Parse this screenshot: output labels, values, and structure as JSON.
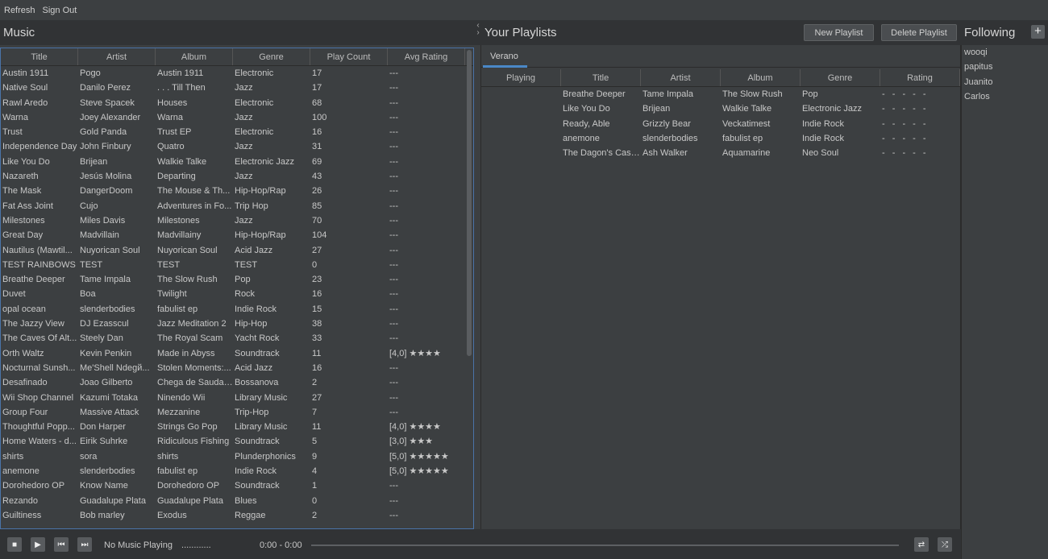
{
  "menu": {
    "refresh": "Refresh",
    "sign_out": "Sign Out"
  },
  "music": {
    "title": "Music",
    "columns": [
      "Title",
      "Artist",
      "Album",
      "Genre",
      "Play Count",
      "Avg Rating"
    ],
    "rows": [
      [
        "Austin 1911",
        "Pogo",
        "Austin 1911",
        "Electronic",
        "17",
        "---"
      ],
      [
        "Native Soul",
        "Danilo Perez",
        ". . . Till Then",
        "Jazz",
        "17",
        "---"
      ],
      [
        "Rawl Aredo",
        "Steve Spacek",
        "Houses",
        "Electronic",
        "68",
        "---"
      ],
      [
        "Warna",
        "Joey Alexander",
        "Warna",
        "Jazz",
        "100",
        "---"
      ],
      [
        "Trust",
        "Gold Panda",
        "Trust EP",
        "Electronic",
        "16",
        "---"
      ],
      [
        "Independence Day",
        "John Finbury",
        "Quatro",
        "Jazz",
        "31",
        "---"
      ],
      [
        "Like You Do",
        "Brijean",
        "Walkie Talke",
        "Electronic Jazz",
        "69",
        "---"
      ],
      [
        "Nazareth",
        "Jesús Molina",
        "Departing",
        "Jazz",
        "43",
        "---"
      ],
      [
        "The Mask",
        "DangerDoom",
        "The Mouse & Th...",
        "Hip-Hop/Rap",
        "26",
        "---"
      ],
      [
        "Fat Ass Joint",
        "Cujo",
        "Adventures in Fo...",
        "Trip Hop",
        "85",
        "---"
      ],
      [
        "Milestones",
        "Miles Davis",
        "Milestones",
        "Jazz",
        "70",
        "---"
      ],
      [
        "Great Day",
        "Madvillain",
        "Madvillainy",
        "Hip-Hop/Rap",
        "104",
        "---"
      ],
      [
        "Nautilus (Mawtil...",
        "Nuyorican Soul",
        "Nuyorican Soul",
        "Acid Jazz",
        "27",
        "---"
      ],
      [
        "TEST RAINBOWS",
        "TEST",
        "TEST",
        "TEST",
        "0",
        "---"
      ],
      [
        "Breathe Deeper",
        "Tame Impala",
        "The Slow Rush",
        "Pop",
        "23",
        "---"
      ],
      [
        "Duvet",
        "Boa",
        "Twilight",
        "Rock",
        "16",
        "---"
      ],
      [
        "opal ocean",
        "slenderbodies",
        "fabulist ep",
        "Indie Rock",
        "15",
        "---"
      ],
      [
        "The Jazzy View",
        "DJ Ezasscul",
        "Jazz Meditation 2",
        "Hip-Hop",
        "38",
        "---"
      ],
      [
        "The Caves Of Alt...",
        "Steely Dan",
        "The Royal Scam",
        "Yacht Rock",
        "33",
        "---"
      ],
      [
        "Orth Waltz",
        "Kevin Penkin",
        "Made in Abyss",
        "Soundtrack",
        "11",
        "[4,0] ★★★★"
      ],
      [
        "Nocturnal Sunsh...",
        "Me'Shell Ndegй...",
        "Stolen Moments:...",
        "Acid Jazz",
        "16",
        "---"
      ],
      [
        "Desafinado",
        "Joao Gilberto",
        "Chega de Saudade",
        "Bossanova",
        "2",
        "---"
      ],
      [
        "Wii Shop Channel",
        "Kazumi Totaka",
        "Ninendo Wii",
        "Library Music",
        "27",
        "---"
      ],
      [
        "Group Four",
        "Massive Attack",
        "Mezzanine",
        "Trip-Hop",
        "7",
        "---"
      ],
      [
        "Thoughtful Popp...",
        "Don Harper",
        "Strings Go Pop",
        "Library Music",
        "11",
        "[4,0] ★★★★"
      ],
      [
        "Home Waters - d...",
        "Eirik Suhrke",
        "Ridiculous Fishing",
        "Soundtrack",
        "5",
        "[3,0] ★★★"
      ],
      [
        "shirts",
        "sora",
        "shirts",
        "Plunderphonics",
        "9",
        "[5,0] ★★★★★"
      ],
      [
        "anemone",
        "slenderbodies",
        "fabulist ep",
        "Indie Rock",
        "4",
        "[5,0] ★★★★★"
      ],
      [
        "Dorohedoro OP",
        "Know Name",
        "Dorohedoro OP",
        "Soundtrack",
        "1",
        "---"
      ],
      [
        "Rezando",
        "Guadalupe Plata",
        "Guadalupe Plata",
        "Blues",
        "0",
        "---"
      ],
      [
        "Guiltiness",
        "Bob marley",
        "Exodus",
        "Reggae",
        "2",
        "---"
      ]
    ]
  },
  "playlists": {
    "title": "Your Playlists",
    "new_button": "New Playlist",
    "delete_button": "Delete Playlist",
    "active_tab": "Verano",
    "columns": [
      "Playing",
      "Title",
      "Artist",
      "Album",
      "Genre",
      "Rating"
    ],
    "rows": [
      [
        "",
        "Breathe Deeper",
        "Tame Impala",
        "The Slow Rush",
        "Pop",
        "- - - - -"
      ],
      [
        "",
        "Like You Do",
        "Brijean",
        "Walkie Talke",
        "Electronic Jazz",
        "- - - - -"
      ],
      [
        "",
        "Ready, Able",
        "Grizzly Bear",
        "Veckatimest",
        "Indie Rock",
        "- - - - -"
      ],
      [
        "",
        "anemone",
        "slenderbodies",
        "fabulist ep",
        "Indie Rock",
        "- - - - -"
      ],
      [
        "",
        "The Dagon's Cash...",
        "Ash Walker",
        "Aquamarine",
        "Neo Soul",
        "- - - - -"
      ]
    ]
  },
  "following": {
    "title": "Following",
    "add_icon": "+",
    "users": [
      "wooqi",
      "papitus",
      "Juanito",
      "Carlos"
    ]
  },
  "player": {
    "now_playing": "No Music Playing",
    "dots": "............",
    "time": "0:00 - 0:00",
    "icons": [
      "stop-icon",
      "play-icon",
      "previous-icon",
      "next-icon",
      "repeat-icon",
      "shuffle-icon"
    ]
  }
}
